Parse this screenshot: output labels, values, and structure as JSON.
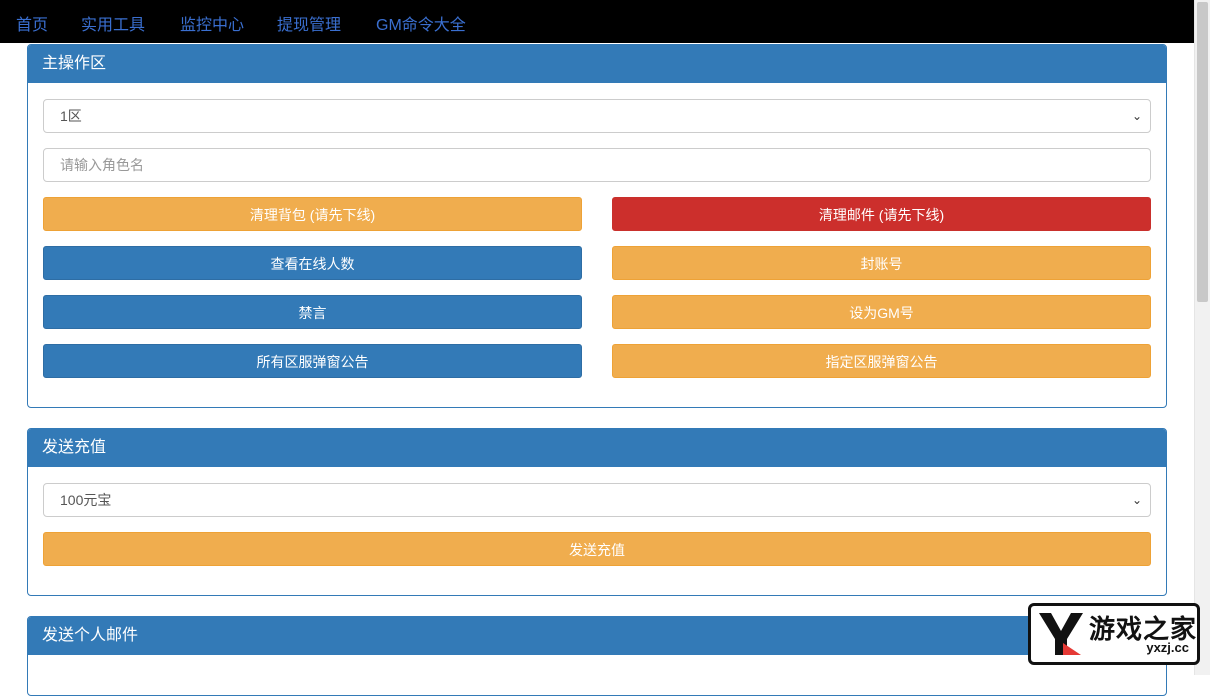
{
  "nav": {
    "items": [
      {
        "label": "首页"
      },
      {
        "label": "实用工具"
      },
      {
        "label": "监控中心"
      },
      {
        "label": "提现管理"
      },
      {
        "label": "GM命令大全"
      }
    ]
  },
  "main_panel": {
    "title": "主操作区",
    "server_select": {
      "value": "1区"
    },
    "role_input": {
      "placeholder": "请输入角色名",
      "value": ""
    },
    "buttons": {
      "clear_bag": "清理背包 (请先下线)",
      "clear_mail": "清理邮件 (请先下线)",
      "online_count": "查看在线人数",
      "ban_account": "封账号",
      "mute": "禁言",
      "set_gm": "设为GM号",
      "all_server_popup": "所有区服弹窗公告",
      "specific_server_popup": "指定区服弹窗公告"
    }
  },
  "recharge_panel": {
    "title": "发送充值",
    "amount_select": {
      "value": "100元宝"
    },
    "send_button": "发送充值"
  },
  "mail_panel": {
    "title": "发送个人邮件"
  },
  "logo": {
    "text": "游戏之家",
    "sub": "yxzj.cc"
  },
  "colors": {
    "primary": "#337ab7",
    "warning": "#f0ad4e",
    "danger": "#cc2f2c",
    "nav_link": "#3a6fd0",
    "topbar": "#000000"
  },
  "icons": {
    "select_arrow": "chevron-down-icon",
    "logo_mark": "yx-logo-icon"
  }
}
